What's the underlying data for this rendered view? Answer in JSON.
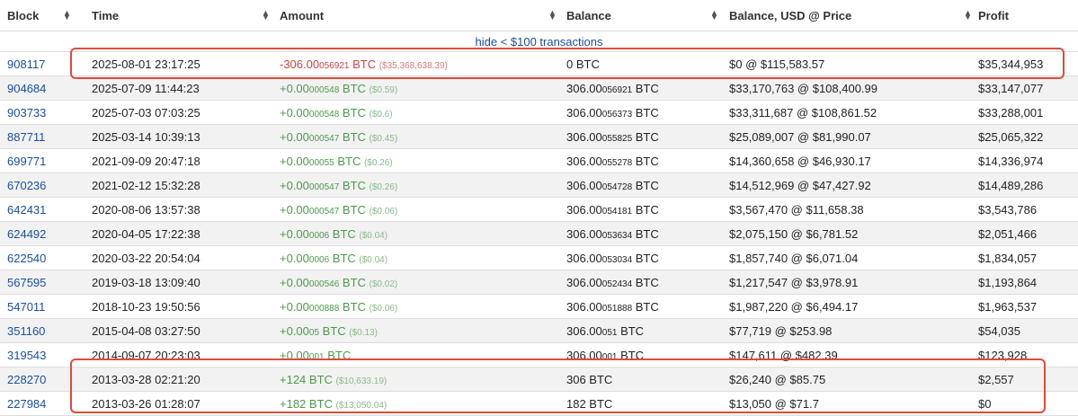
{
  "columns": {
    "block": "Block",
    "time": "Time",
    "amount": "Amount",
    "balance": "Balance",
    "balance_usd": "Balance, USD @ Price",
    "profit": "Profit"
  },
  "hide_link": "hide < $100 transactions",
  "highlight_color": "#e04a3c",
  "rows": [
    {
      "block": "908117",
      "time": "2025-08-01 23:17:25",
      "sign": "neg",
      "amt_main": "-306.00",
      "amt_small": "056921",
      "amt_unit": " BTC ",
      "amt_usd": "($35,368,638.39)",
      "bal_main": "0 BTC",
      "bal_small": "",
      "bal_unit": "",
      "bal_usd": "$0 @ $115,583.57",
      "profit": "$35,344,953"
    },
    {
      "block": "904684",
      "time": "2025-07-09 11:44:23",
      "sign": "pos",
      "amt_main": "+0.00",
      "amt_small": "000548",
      "amt_unit": " BTC ",
      "amt_usd": "($0.59)",
      "bal_main": "306.00",
      "bal_small": "056921",
      "bal_unit": " BTC",
      "bal_usd": "$33,170,763 @ $108,400.99",
      "profit": "$33,147,077"
    },
    {
      "block": "903733",
      "time": "2025-07-03 07:03:25",
      "sign": "pos",
      "amt_main": "+0.00",
      "amt_small": "000548",
      "amt_unit": " BTC ",
      "amt_usd": "($0.6)",
      "bal_main": "306.00",
      "bal_small": "056373",
      "bal_unit": " BTC",
      "bal_usd": "$33,311,687 @ $108,861.52",
      "profit": "$33,288,001"
    },
    {
      "block": "887711",
      "time": "2025-03-14 10:39:13",
      "sign": "pos",
      "amt_main": "+0.00",
      "amt_small": "000547",
      "amt_unit": " BTC ",
      "amt_usd": "($0.45)",
      "bal_main": "306.00",
      "bal_small": "055825",
      "bal_unit": " BTC",
      "bal_usd": "$25,089,007 @ $81,990.07",
      "profit": "$25,065,322"
    },
    {
      "block": "699771",
      "time": "2021-09-09 20:47:18",
      "sign": "pos",
      "amt_main": "+0.00",
      "amt_small": "00055",
      "amt_unit": " BTC ",
      "amt_usd": "($0.26)",
      "bal_main": "306.00",
      "bal_small": "055278",
      "bal_unit": " BTC",
      "bal_usd": "$14,360,658 @ $46,930.17",
      "profit": "$14,336,974"
    },
    {
      "block": "670236",
      "time": "2021-02-12 15:32:28",
      "sign": "pos",
      "amt_main": "+0.00",
      "amt_small": "000547",
      "amt_unit": " BTC ",
      "amt_usd": "($0.26)",
      "bal_main": "306.00",
      "bal_small": "054728",
      "bal_unit": " BTC",
      "bal_usd": "$14,512,969 @ $47,427.92",
      "profit": "$14,489,286"
    },
    {
      "block": "642431",
      "time": "2020-08-06 13:57:38",
      "sign": "pos",
      "amt_main": "+0.00",
      "amt_small": "000547",
      "amt_unit": " BTC ",
      "amt_usd": "($0.06)",
      "bal_main": "306.00",
      "bal_small": "054181",
      "bal_unit": " BTC",
      "bal_usd": "$3,567,470 @ $11,658.38",
      "profit": "$3,543,786"
    },
    {
      "block": "624492",
      "time": "2020-04-05 17:22:38",
      "sign": "pos",
      "amt_main": "+0.00",
      "amt_small": "0006",
      "amt_unit": " BTC ",
      "amt_usd": "($0.04)",
      "bal_main": "306.00",
      "bal_small": "053634",
      "bal_unit": " BTC",
      "bal_usd": "$2,075,150 @ $6,781.52",
      "profit": "$2,051,466"
    },
    {
      "block": "622540",
      "time": "2020-03-22 20:54:04",
      "sign": "pos",
      "amt_main": "+0.00",
      "amt_small": "0006",
      "amt_unit": " BTC ",
      "amt_usd": "($0.04)",
      "bal_main": "306.00",
      "bal_small": "053034",
      "bal_unit": " BTC",
      "bal_usd": "$1,857,740 @ $6,071.04",
      "profit": "$1,834,057"
    },
    {
      "block": "567595",
      "time": "2019-03-18 13:09:40",
      "sign": "pos",
      "amt_main": "+0.00",
      "amt_small": "000546",
      "amt_unit": " BTC ",
      "amt_usd": "($0.02)",
      "bal_main": "306.00",
      "bal_small": "052434",
      "bal_unit": " BTC",
      "bal_usd": "$1,217,547 @ $3,978.91",
      "profit": "$1,193,864"
    },
    {
      "block": "547011",
      "time": "2018-10-23 19:50:56",
      "sign": "pos",
      "amt_main": "+0.00",
      "amt_small": "000888",
      "amt_unit": " BTC ",
      "amt_usd": "($0.06)",
      "bal_main": "306.00",
      "bal_small": "051888",
      "bal_unit": " BTC",
      "bal_usd": "$1,987,220 @ $6,494.17",
      "profit": "$1,963,537"
    },
    {
      "block": "351160",
      "time": "2015-04-08 03:27:50",
      "sign": "pos",
      "amt_main": "+0.00",
      "amt_small": "05",
      "amt_unit": " BTC ",
      "amt_usd": "($0.13)",
      "bal_main": "306.00",
      "bal_small": "051",
      "bal_unit": " BTC",
      "bal_usd": "$77,719 @ $253.98",
      "profit": "$54,035"
    },
    {
      "block": "319543",
      "time": "2014-09-07 20:23:03",
      "sign": "pos",
      "amt_main": "+0.00",
      "amt_small": "001",
      "amt_unit": " BTC",
      "amt_usd": "",
      "bal_main": "306.00",
      "bal_small": "001",
      "bal_unit": " BTC",
      "bal_usd": "$147,611 @ $482.39",
      "profit": "$123,928"
    },
    {
      "block": "228270",
      "time": "2013-03-28 02:21:20",
      "sign": "pos",
      "amt_main": "+124 BTC ",
      "amt_small": "",
      "amt_unit": "",
      "amt_usd": "($10,633.19)",
      "bal_main": "306 BTC",
      "bal_small": "",
      "bal_unit": "",
      "bal_usd": "$26,240 @ $85.75",
      "profit": "$2,557"
    },
    {
      "block": "227984",
      "time": "2013-03-26 01:28:07",
      "sign": "pos",
      "amt_main": "+182 BTC ",
      "amt_small": "",
      "amt_unit": "",
      "amt_usd": "($13,050.04)",
      "bal_main": "182 BTC",
      "bal_small": "",
      "bal_unit": "",
      "bal_usd": "$13,050 @ $71.7",
      "profit": "$0"
    }
  ]
}
